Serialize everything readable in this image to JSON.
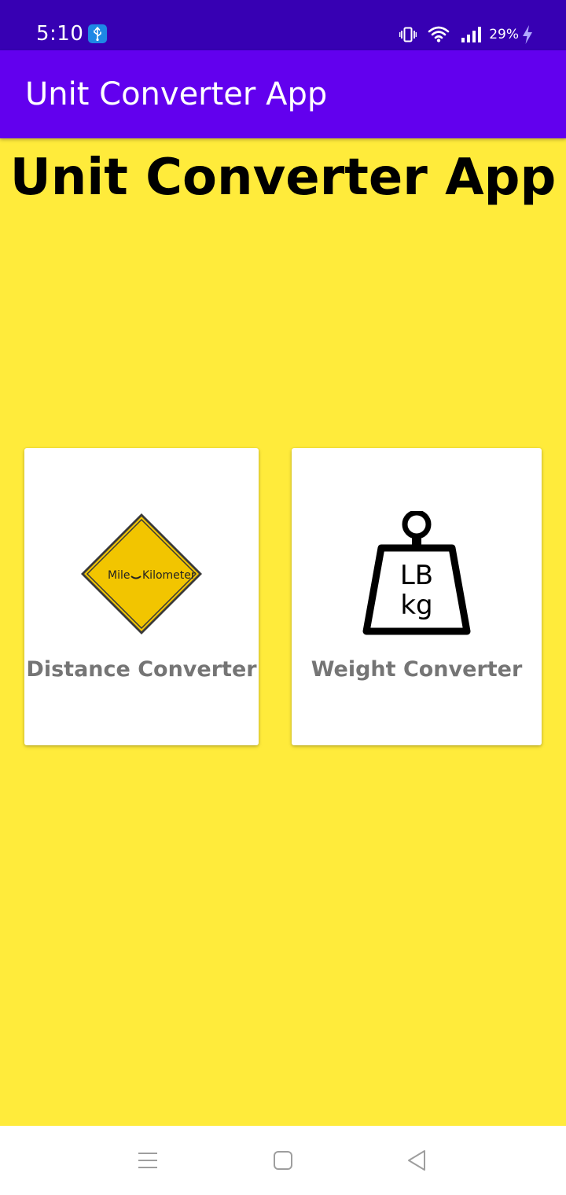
{
  "status_bar": {
    "time": "5:10",
    "battery_percent": "29%"
  },
  "app_bar": {
    "title": "Unit Converter App"
  },
  "page": {
    "heading": "Unit Converter App"
  },
  "cards": {
    "distance": {
      "label": "Distance Converter",
      "sign_text_left": "Mile",
      "sign_text_right": "Kilometer",
      "icon": "mile-kilometer-road-sign-icon"
    },
    "weight": {
      "label": "Weight Converter",
      "weight_text_top": "LB",
      "weight_text_bottom": "kg",
      "icon": "lb-kg-weight-icon"
    }
  },
  "colors": {
    "status_bar": "#3700b3",
    "app_bar": "#6200ee",
    "background": "#ffeb3b",
    "card": "#ffffff",
    "card_label": "#757575",
    "sign_fill": "#f2c500"
  },
  "nav_bar": {
    "icons": [
      "menu-icon",
      "home-icon",
      "back-icon"
    ]
  }
}
